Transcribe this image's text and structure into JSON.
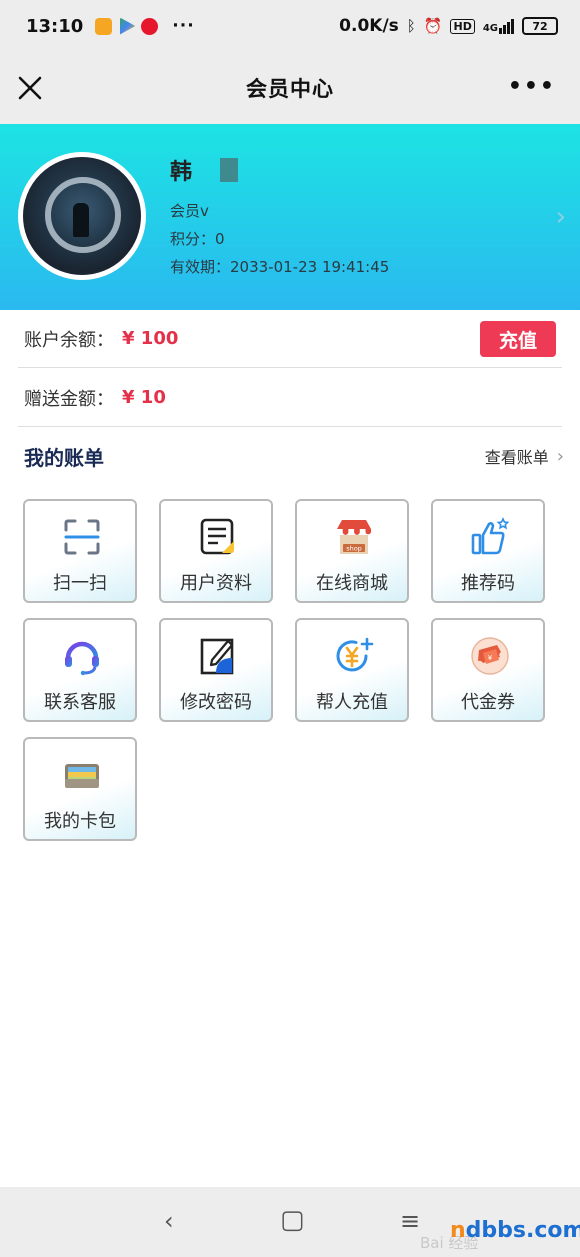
{
  "status_bar": {
    "time": "13:10",
    "dots": "···",
    "network_speed": "0.0K/s",
    "hd": "HD",
    "signal": "4G",
    "battery": "72"
  },
  "header": {
    "title": "会员中心",
    "more": "•••"
  },
  "profile": {
    "name": "韩",
    "level": "会员v",
    "points": "积分：0",
    "expiry": "有效期：2033-01-23 19:41:45"
  },
  "balance": {
    "account_label": "账户余额：",
    "account_value": "¥ 100",
    "recharge_button": "充值",
    "bonus_label": "赠送金额：",
    "bonus_value": "¥ 10"
  },
  "bills": {
    "title": "我的账单",
    "view_link": "查看账单"
  },
  "grid": [
    {
      "label": "扫一扫",
      "icon": "scan-icon"
    },
    {
      "label": "用户资料",
      "icon": "profile-document-icon"
    },
    {
      "label": "在线商城",
      "icon": "shop-icon"
    },
    {
      "label": "推荐码",
      "icon": "thumbs-up-icon"
    },
    {
      "label": "联系客服",
      "icon": "headset-icon"
    },
    {
      "label": "修改密码",
      "icon": "edit-icon"
    },
    {
      "label": "帮人充值",
      "icon": "yuan-recharge-icon"
    },
    {
      "label": "代金券",
      "icon": "coupon-icon"
    },
    {
      "label": "我的卡包",
      "icon": "wallet-icon"
    }
  ],
  "navbar": {
    "back": "‹",
    "home": "▢",
    "menu": "≡"
  },
  "watermark": {
    "baidu": "Bai 经验",
    "site_prefix": "n",
    "site_rest": "dbbs.com"
  },
  "colors": {
    "banner_top": "#1de3e3",
    "banner_bottom": "#2ab9ef",
    "accent_red": "#ee3a55",
    "amount_red": "#e5304a",
    "bill_title": "#1a2b55"
  }
}
